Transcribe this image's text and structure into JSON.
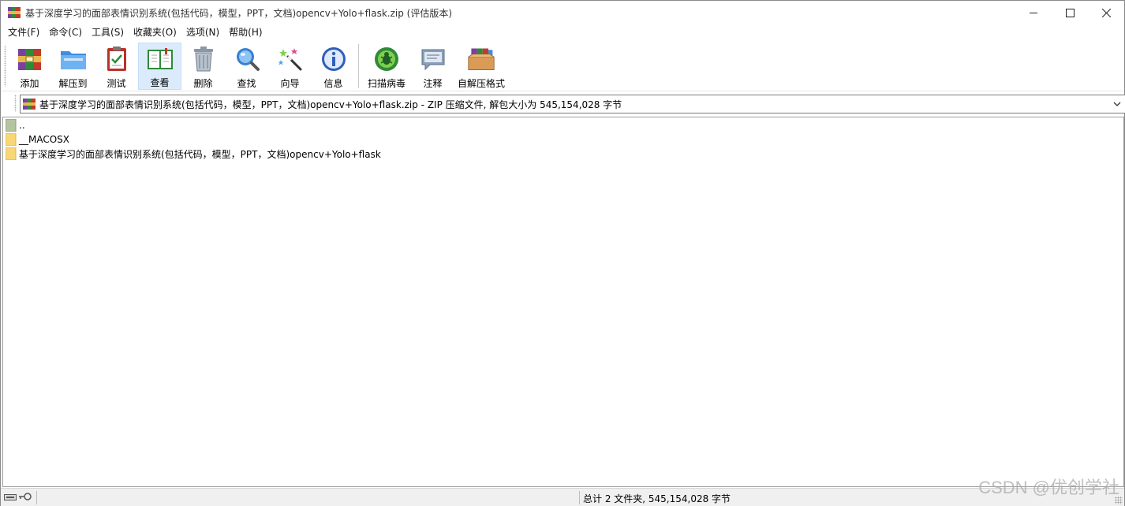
{
  "window": {
    "title": "基于深度学习的面部表情识别系统(包括代码，模型，PPT，文档)opencv+Yolo+flask.zip (评估版本)",
    "controls": {
      "minimize": "—",
      "maximize": "☐",
      "close": "✕"
    }
  },
  "menu": [
    {
      "label": "文件(F)"
    },
    {
      "label": "命令(C)"
    },
    {
      "label": "工具(S)"
    },
    {
      "label": "收藏夹(O)"
    },
    {
      "label": "选项(N)"
    },
    {
      "label": "帮助(H)"
    }
  ],
  "toolbar": [
    {
      "label": "添加",
      "icon": "add-archive-icon"
    },
    {
      "label": "解压到",
      "icon": "extract-folder-icon"
    },
    {
      "label": "测试",
      "icon": "test-clipboard-icon"
    },
    {
      "label": "查看",
      "icon": "view-book-icon",
      "active": true
    },
    {
      "label": "删除",
      "icon": "trash-icon"
    },
    {
      "label": "查找",
      "icon": "magnifier-icon"
    },
    {
      "label": "向导",
      "icon": "wizard-wand-icon"
    },
    {
      "label": "信息",
      "icon": "info-icon"
    },
    {
      "label": "扫描病毒",
      "icon": "virus-scan-icon"
    },
    {
      "label": "注释",
      "icon": "comment-icon"
    },
    {
      "label": "自解压格式",
      "icon": "sfx-box-icon"
    }
  ],
  "address": {
    "text": "基于深度学习的面部表情识别系统(包括代码，模型，PPT，文档)opencv+Yolo+flask.zip - ZIP 压缩文件, 解包大小为 545,154,028 字节"
  },
  "files": [
    {
      "name": "..",
      "type": "parent"
    },
    {
      "name": "__MACOSX",
      "type": "folder"
    },
    {
      "name": "基于深度学习的面部表情识别系统(包括代码，模型，PPT，文档)opencv+Yolo+flask",
      "type": "folder"
    }
  ],
  "status": {
    "summary": "总计 2 文件夹, 545,154,028 字节"
  },
  "watermark": "CSDN @优创学社",
  "colors": {
    "folder": "#f8d775",
    "active_tool": "#dcebfc",
    "statusbar": "#f0f0f0"
  }
}
